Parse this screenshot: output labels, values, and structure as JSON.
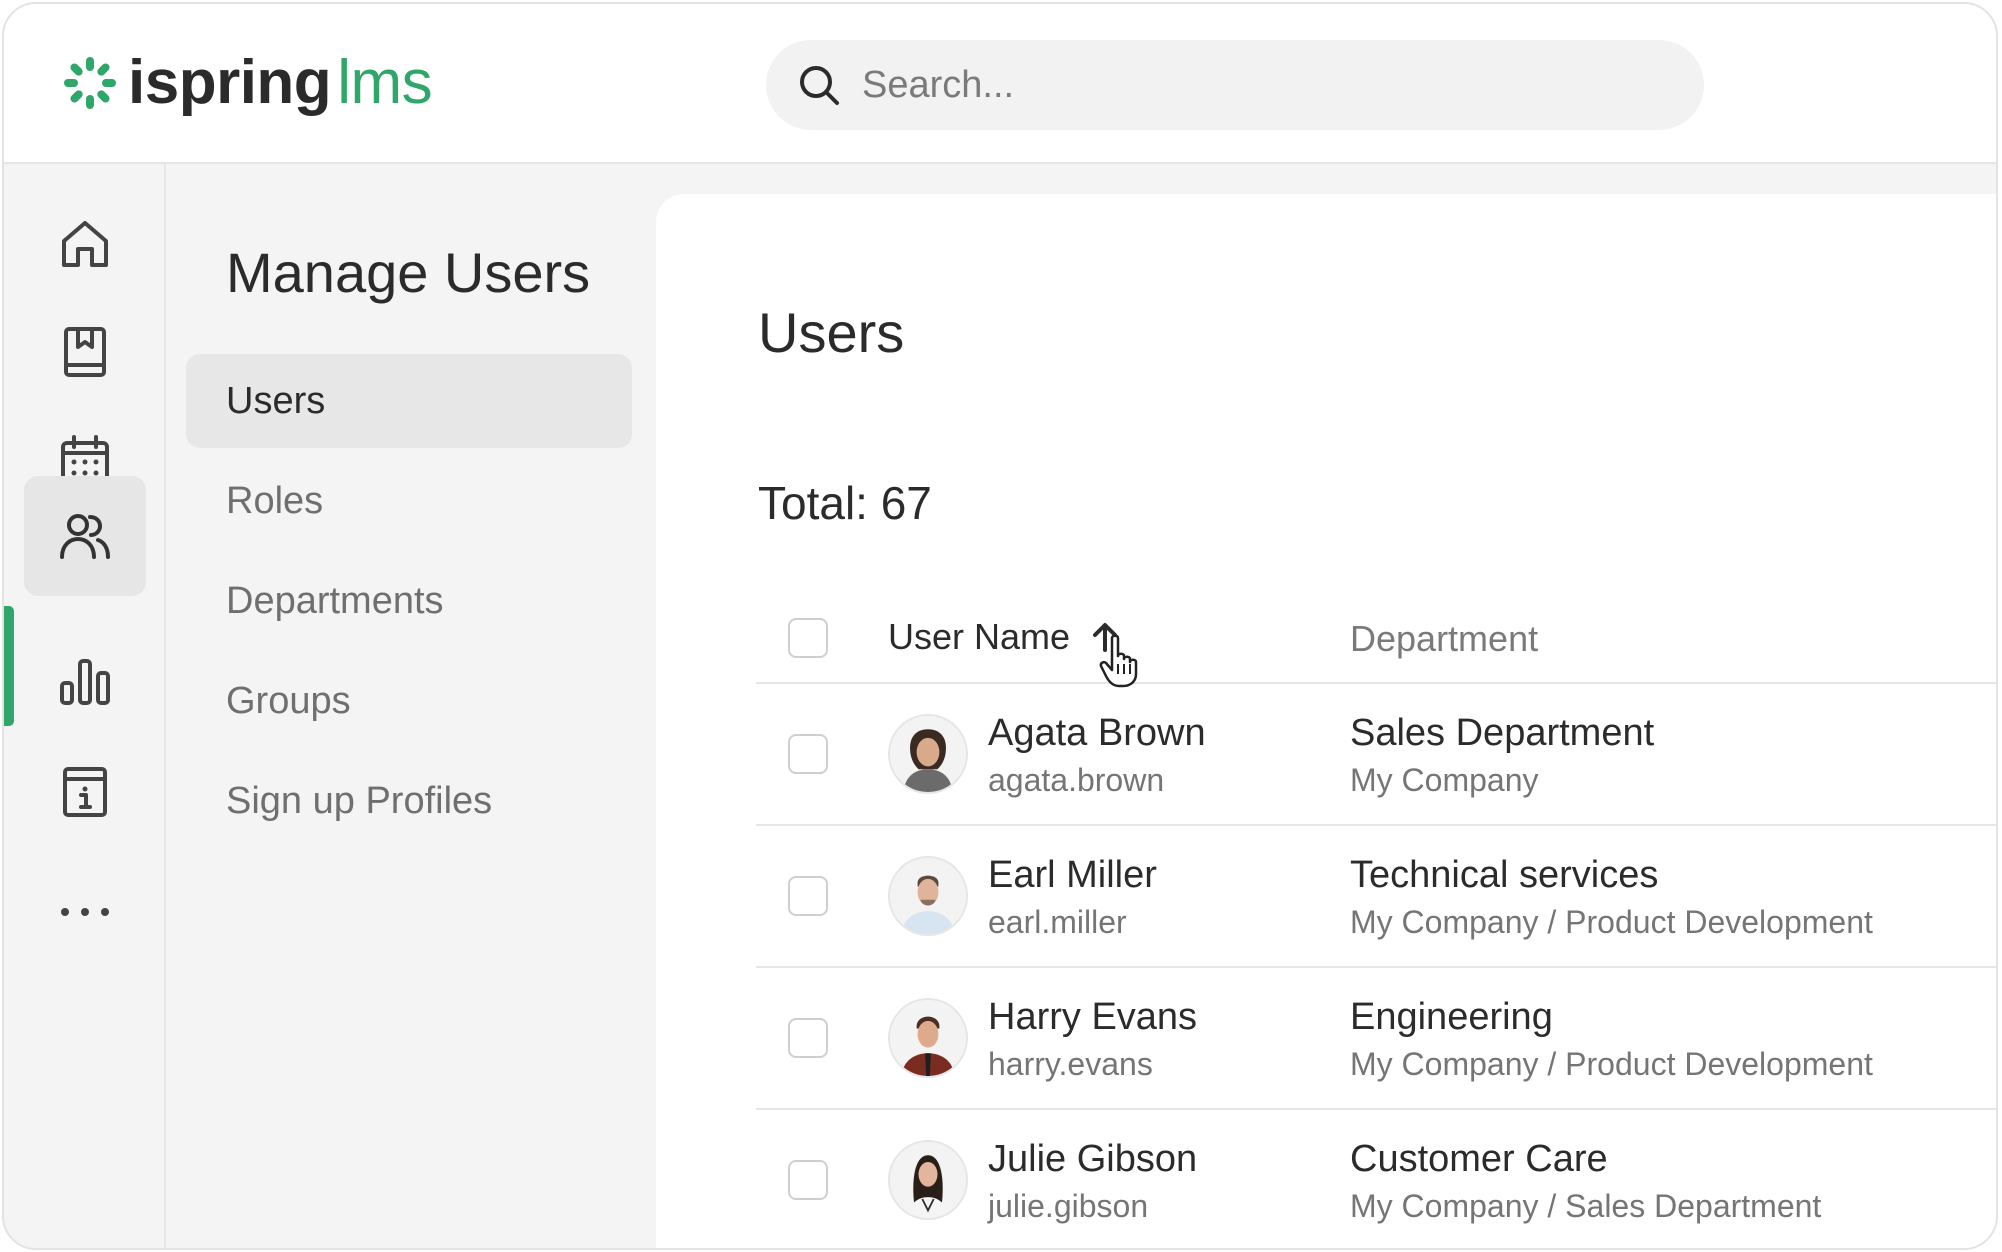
{
  "header": {
    "logo_brand": "ispring",
    "logo_product": "lms",
    "search_placeholder": "Search...",
    "colors": {
      "brand_green": "#2fa76a",
      "text": "#2b2b2b"
    }
  },
  "rail": {
    "items": [
      {
        "icon": "home-icon"
      },
      {
        "icon": "book-icon"
      },
      {
        "icon": "calendar-icon"
      },
      {
        "icon": "users-icon",
        "active": true
      },
      {
        "icon": "bar-chart-icon"
      },
      {
        "icon": "info-icon"
      },
      {
        "icon": "more-icon"
      }
    ]
  },
  "subnav": {
    "title": "Manage Users",
    "items": [
      {
        "label": "Users",
        "active": true
      },
      {
        "label": "Roles"
      },
      {
        "label": "Departments"
      },
      {
        "label": "Groups"
      },
      {
        "label": "Sign up Profiles"
      }
    ]
  },
  "main": {
    "title": "Users",
    "total": "Total: 67",
    "columns": {
      "name": "User Name",
      "department": "Department"
    },
    "sort": {
      "column": "User Name",
      "direction": "ascending",
      "icon": "arrow-up-icon"
    },
    "rows": [
      {
        "name": "Agata Brown",
        "login": "agata.brown",
        "department": "Sales Department",
        "path": "My Company"
      },
      {
        "name": "Earl Miller",
        "login": "earl.miller",
        "department": "Technical services",
        "path": "My Company / Product Development"
      },
      {
        "name": "Harry Evans",
        "login": "harry.evans",
        "department": "Engineering",
        "path": "My Company / Product Development"
      },
      {
        "name": "Julie Gibson",
        "login": "julie.gibson",
        "department": "Customer Care",
        "path": "My Company / Sales Department"
      }
    ]
  }
}
